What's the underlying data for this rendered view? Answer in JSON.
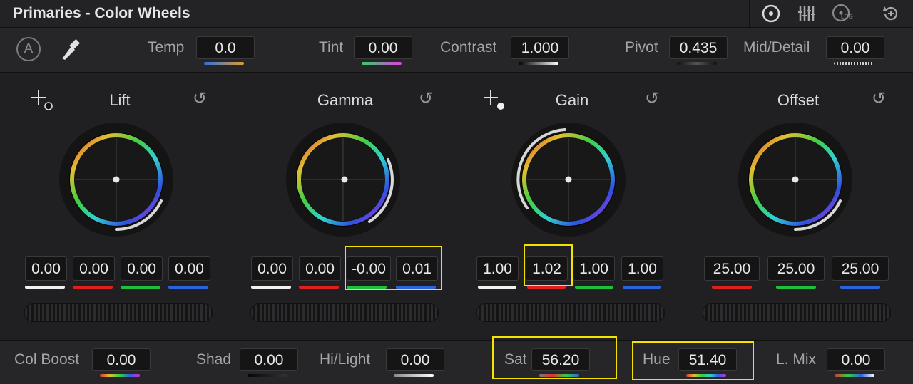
{
  "panel": {
    "title": "Primaries - Color Wheels"
  },
  "topbar_icons": [
    "wheels-mode-icon",
    "bars-mode-icon",
    "log-mode-icon",
    "reset-all-icon"
  ],
  "log_label": "LOG",
  "toolbar": {
    "auto_label": "A",
    "temp": {
      "label": "Temp",
      "value": "0.0"
    },
    "tint": {
      "label": "Tint",
      "value": "0.00"
    },
    "contrast": {
      "label": "Contrast",
      "value": "1.000"
    },
    "pivot": {
      "label": "Pivot",
      "value": "0.435"
    },
    "mid_detail": {
      "label": "Mid/Detail",
      "value": "0.00"
    }
  },
  "wheels": [
    {
      "name": "Lift",
      "values": [
        "0.00",
        "0.00",
        "0.00",
        "0.00"
      ]
    },
    {
      "name": "Gamma",
      "values": [
        "0.00",
        "0.00",
        "-0.00",
        "0.01"
      ]
    },
    {
      "name": "Gain",
      "values": [
        "1.00",
        "1.02",
        "1.00",
        "1.00"
      ]
    },
    {
      "name": "Offset",
      "values": [
        "25.00",
        "25.00",
        "25.00"
      ]
    }
  ],
  "bottom": {
    "col_boost": {
      "label": "Col Boost",
      "value": "0.00"
    },
    "shad": {
      "label": "Shad",
      "value": "0.00"
    },
    "hi_light": {
      "label": "Hi/Light",
      "value": "0.00"
    },
    "sat": {
      "label": "Sat",
      "value": "56.20"
    },
    "hue": {
      "label": "Hue",
      "value": "51.40"
    },
    "l_mix": {
      "label": "L. Mix",
      "value": "0.00"
    }
  },
  "colors": {
    "highlight": "#f2e400",
    "y_channel": "#f0f0f0",
    "red": "#e02020",
    "green": "#1fbf3a",
    "blue": "#2a62e0"
  }
}
